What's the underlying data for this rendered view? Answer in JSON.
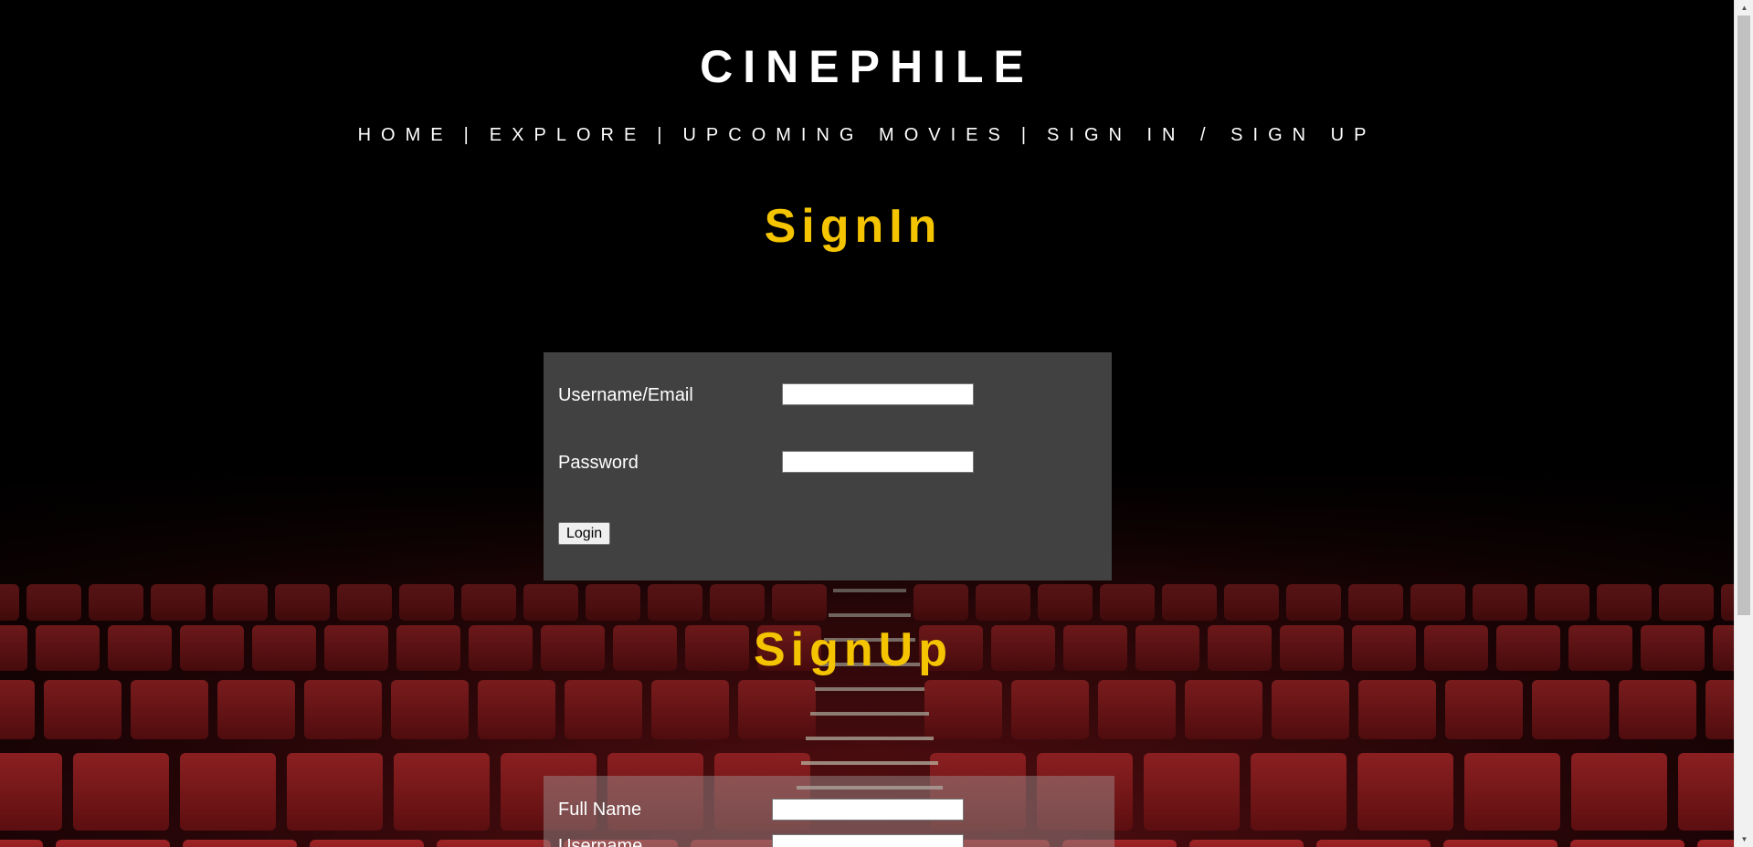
{
  "header": {
    "title": "CINEPHILE"
  },
  "nav": {
    "items": [
      "HOME",
      "EXPLORE",
      "UPCOMING MOVIES",
      "SIGN IN / SIGN UP"
    ],
    "separator": "|"
  },
  "signin": {
    "title": "SignIn",
    "username_label": "Username/Email",
    "username_value": "",
    "password_label": "Password",
    "password_value": "",
    "login_button": "Login"
  },
  "signup": {
    "title": "SignUp",
    "fullname_label": "Full Name",
    "fullname_value": "",
    "username_label": "Username",
    "username_value": ""
  },
  "colors": {
    "accent": "#f5c400",
    "panel": "#414141",
    "background": "#000000",
    "seats": "#8b1a1c"
  },
  "icons": {
    "scroll_up": "triangle-up-icon",
    "scroll_down": "triangle-down-icon"
  }
}
